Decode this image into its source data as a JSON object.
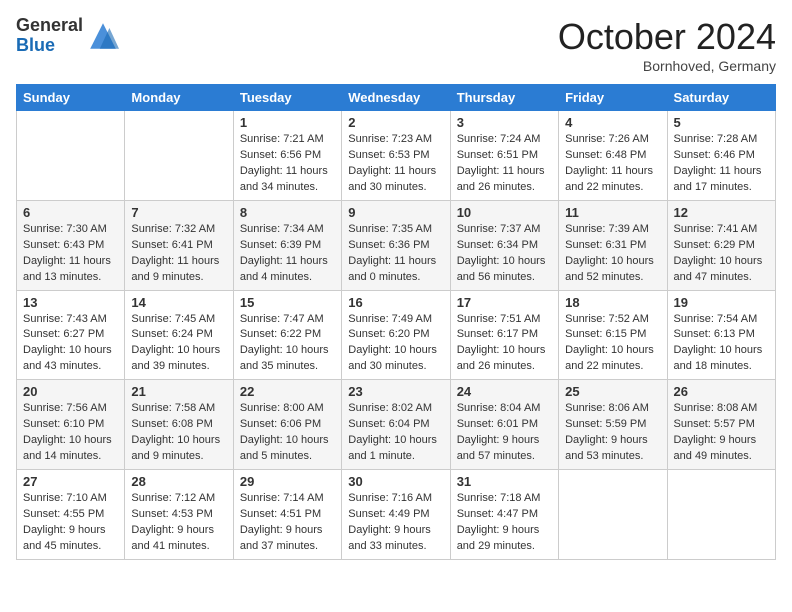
{
  "logo": {
    "general": "General",
    "blue": "Blue"
  },
  "title": "October 2024",
  "location": "Bornhoved, Germany",
  "days_of_week": [
    "Sunday",
    "Monday",
    "Tuesday",
    "Wednesday",
    "Thursday",
    "Friday",
    "Saturday"
  ],
  "weeks": [
    [
      {
        "day": "",
        "info": ""
      },
      {
        "day": "",
        "info": ""
      },
      {
        "day": "1",
        "info": "Sunrise: 7:21 AM\nSunset: 6:56 PM\nDaylight: 11 hours\nand 34 minutes."
      },
      {
        "day": "2",
        "info": "Sunrise: 7:23 AM\nSunset: 6:53 PM\nDaylight: 11 hours\nand 30 minutes."
      },
      {
        "day": "3",
        "info": "Sunrise: 7:24 AM\nSunset: 6:51 PM\nDaylight: 11 hours\nand 26 minutes."
      },
      {
        "day": "4",
        "info": "Sunrise: 7:26 AM\nSunset: 6:48 PM\nDaylight: 11 hours\nand 22 minutes."
      },
      {
        "day": "5",
        "info": "Sunrise: 7:28 AM\nSunset: 6:46 PM\nDaylight: 11 hours\nand 17 minutes."
      }
    ],
    [
      {
        "day": "6",
        "info": "Sunrise: 7:30 AM\nSunset: 6:43 PM\nDaylight: 11 hours\nand 13 minutes."
      },
      {
        "day": "7",
        "info": "Sunrise: 7:32 AM\nSunset: 6:41 PM\nDaylight: 11 hours\nand 9 minutes."
      },
      {
        "day": "8",
        "info": "Sunrise: 7:34 AM\nSunset: 6:39 PM\nDaylight: 11 hours\nand 4 minutes."
      },
      {
        "day": "9",
        "info": "Sunrise: 7:35 AM\nSunset: 6:36 PM\nDaylight: 11 hours\nand 0 minutes."
      },
      {
        "day": "10",
        "info": "Sunrise: 7:37 AM\nSunset: 6:34 PM\nDaylight: 10 hours\nand 56 minutes."
      },
      {
        "day": "11",
        "info": "Sunrise: 7:39 AM\nSunset: 6:31 PM\nDaylight: 10 hours\nand 52 minutes."
      },
      {
        "day": "12",
        "info": "Sunrise: 7:41 AM\nSunset: 6:29 PM\nDaylight: 10 hours\nand 47 minutes."
      }
    ],
    [
      {
        "day": "13",
        "info": "Sunrise: 7:43 AM\nSunset: 6:27 PM\nDaylight: 10 hours\nand 43 minutes."
      },
      {
        "day": "14",
        "info": "Sunrise: 7:45 AM\nSunset: 6:24 PM\nDaylight: 10 hours\nand 39 minutes."
      },
      {
        "day": "15",
        "info": "Sunrise: 7:47 AM\nSunset: 6:22 PM\nDaylight: 10 hours\nand 35 minutes."
      },
      {
        "day": "16",
        "info": "Sunrise: 7:49 AM\nSunset: 6:20 PM\nDaylight: 10 hours\nand 30 minutes."
      },
      {
        "day": "17",
        "info": "Sunrise: 7:51 AM\nSunset: 6:17 PM\nDaylight: 10 hours\nand 26 minutes."
      },
      {
        "day": "18",
        "info": "Sunrise: 7:52 AM\nSunset: 6:15 PM\nDaylight: 10 hours\nand 22 minutes."
      },
      {
        "day": "19",
        "info": "Sunrise: 7:54 AM\nSunset: 6:13 PM\nDaylight: 10 hours\nand 18 minutes."
      }
    ],
    [
      {
        "day": "20",
        "info": "Sunrise: 7:56 AM\nSunset: 6:10 PM\nDaylight: 10 hours\nand 14 minutes."
      },
      {
        "day": "21",
        "info": "Sunrise: 7:58 AM\nSunset: 6:08 PM\nDaylight: 10 hours\nand 9 minutes."
      },
      {
        "day": "22",
        "info": "Sunrise: 8:00 AM\nSunset: 6:06 PM\nDaylight: 10 hours\nand 5 minutes."
      },
      {
        "day": "23",
        "info": "Sunrise: 8:02 AM\nSunset: 6:04 PM\nDaylight: 10 hours\nand 1 minute."
      },
      {
        "day": "24",
        "info": "Sunrise: 8:04 AM\nSunset: 6:01 PM\nDaylight: 9 hours\nand 57 minutes."
      },
      {
        "day": "25",
        "info": "Sunrise: 8:06 AM\nSunset: 5:59 PM\nDaylight: 9 hours\nand 53 minutes."
      },
      {
        "day": "26",
        "info": "Sunrise: 8:08 AM\nSunset: 5:57 PM\nDaylight: 9 hours\nand 49 minutes."
      }
    ],
    [
      {
        "day": "27",
        "info": "Sunrise: 7:10 AM\nSunset: 4:55 PM\nDaylight: 9 hours\nand 45 minutes."
      },
      {
        "day": "28",
        "info": "Sunrise: 7:12 AM\nSunset: 4:53 PM\nDaylight: 9 hours\nand 41 minutes."
      },
      {
        "day": "29",
        "info": "Sunrise: 7:14 AM\nSunset: 4:51 PM\nDaylight: 9 hours\nand 37 minutes."
      },
      {
        "day": "30",
        "info": "Sunrise: 7:16 AM\nSunset: 4:49 PM\nDaylight: 9 hours\nand 33 minutes."
      },
      {
        "day": "31",
        "info": "Sunrise: 7:18 AM\nSunset: 4:47 PM\nDaylight: 9 hours\nand 29 minutes."
      },
      {
        "day": "",
        "info": ""
      },
      {
        "day": "",
        "info": ""
      }
    ]
  ]
}
